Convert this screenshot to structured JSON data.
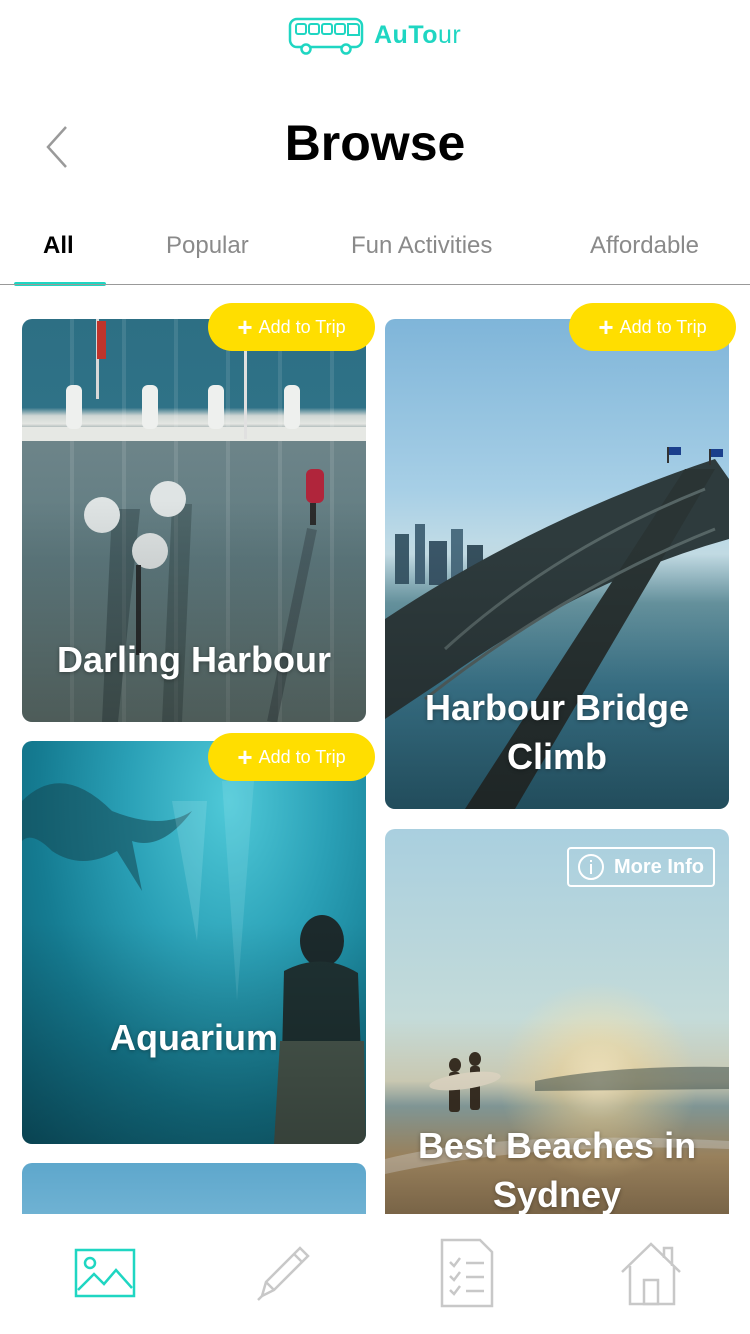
{
  "app": {
    "logo_bold": "AuTo",
    "logo_light": "ur"
  },
  "header": {
    "title": "Browse"
  },
  "tabs": [
    {
      "label": "All",
      "active": true
    },
    {
      "label": "Popular",
      "active": false
    },
    {
      "label": "Fun Activities",
      "active": false
    },
    {
      "label": "Affordable",
      "active": false
    }
  ],
  "cards": {
    "darling": {
      "title": "Darling Harbour",
      "action": "Add to Trip"
    },
    "bridge": {
      "title": "Harbour Bridge Climb",
      "action": "Add to Trip"
    },
    "aquarium": {
      "title": "Aquarium",
      "action": "Add to Trip"
    },
    "beaches": {
      "title": "Best Beaches in Sydney",
      "action": "More Info"
    }
  },
  "bottom_nav": [
    {
      "icon": "image-icon",
      "active": true
    },
    {
      "icon": "pencil-icon",
      "active": false
    },
    {
      "icon": "checklist-icon",
      "active": false
    },
    {
      "icon": "home-icon",
      "active": false
    }
  ],
  "colors": {
    "accent": "#1fd6c2",
    "add_button": "#ffde00",
    "inactive_icon": "#c8c8c8"
  }
}
